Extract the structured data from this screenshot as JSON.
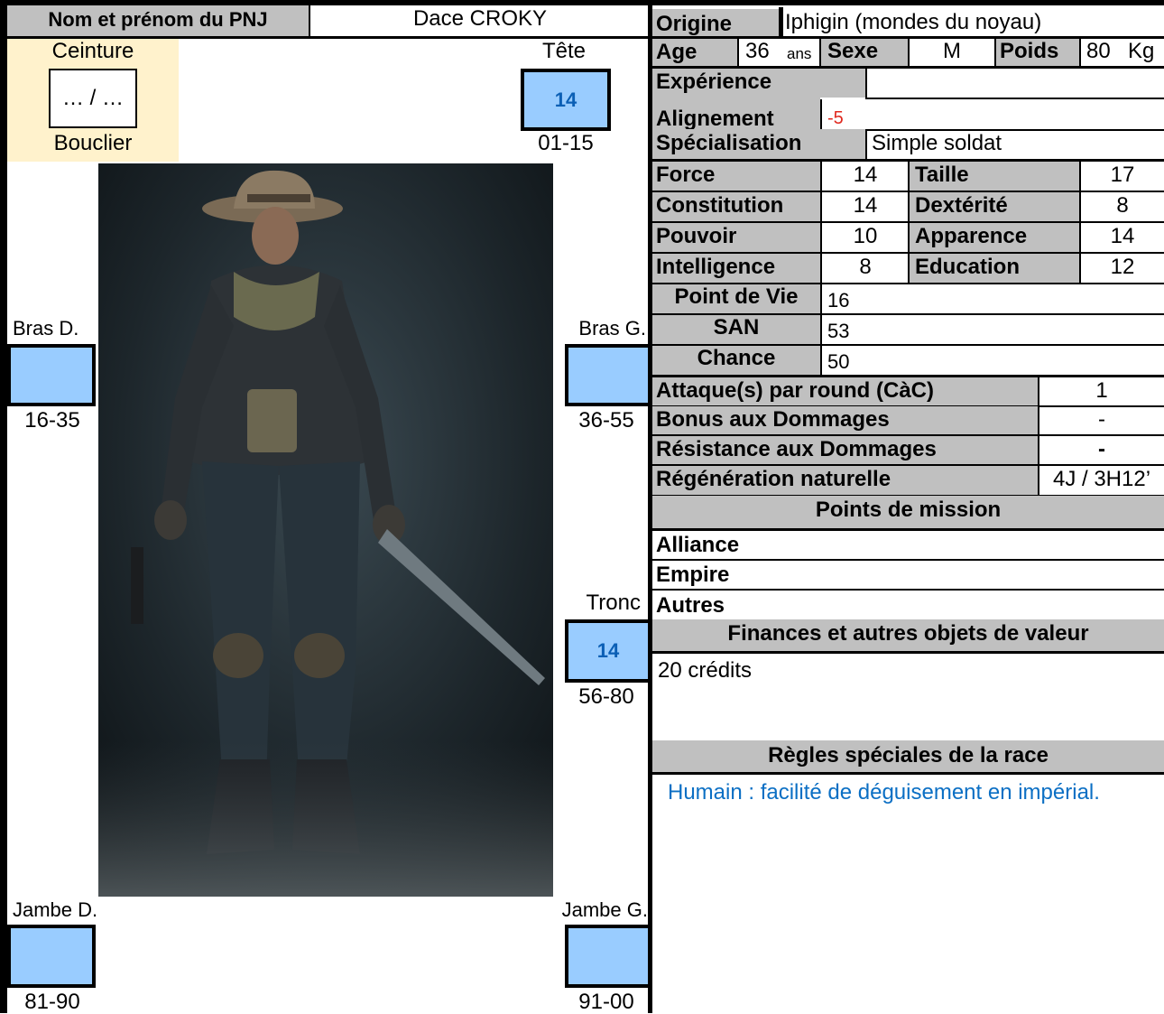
{
  "header": {
    "name_label": "Nom et prénom du PNJ",
    "name_value": "Dace CROKY"
  },
  "armor": {
    "ceinture_label": "Ceinture",
    "value": "… / …",
    "bouclier_label": "Bouclier"
  },
  "locations": {
    "tete": {
      "label": "Tête",
      "value": "14",
      "range": "01-15"
    },
    "bras_d": {
      "label": "Bras D.",
      "value": "",
      "range": "16-35"
    },
    "bras_g": {
      "label": "Bras G.",
      "value": "",
      "range": "36-55"
    },
    "tronc": {
      "label": "Tronc",
      "value": "14",
      "range": "56-80"
    },
    "jambe_d": {
      "label": "Jambe D.",
      "value": "",
      "range": "81-90"
    },
    "jambe_g": {
      "label": "Jambe G.",
      "value": "",
      "range": "91-00"
    }
  },
  "identity": {
    "origine_label": "Origine",
    "origine_value": "Iphigin (mondes du noyau)",
    "age_label": "Age",
    "age_value": "36",
    "age_unit": "ans",
    "sexe_label": "Sexe",
    "sexe_value": "M",
    "poids_label": "Poids",
    "poids_value": "80",
    "poids_unit": "Kg",
    "experience_label": "Expérience",
    "experience_value": "",
    "alignement_label": "Alignement",
    "alignement_value": "-5",
    "specialisation_label": "Spécialisation",
    "specialisation_value": "Simple soldat"
  },
  "stats": [
    {
      "l1": "Force",
      "v1": "14",
      "l2": "Taille",
      "v2": "17"
    },
    {
      "l1": "Constitution",
      "v1": "14",
      "l2": "Dextérité",
      "v2": "8"
    },
    {
      "l1": "Pouvoir",
      "v1": "10",
      "l2": "Apparence",
      "v2": "14"
    },
    {
      "l1": "Intelligence",
      "v1": "8",
      "l2": "Education",
      "v2": "12"
    }
  ],
  "derived": [
    {
      "label": "Point de Vie",
      "value": "16"
    },
    {
      "label": "SAN",
      "value": "53"
    },
    {
      "label": "Chance",
      "value": "50"
    }
  ],
  "combat": [
    {
      "label": "Attaque(s) par round (CàC)",
      "value": "1"
    },
    {
      "label": "Bonus aux Dommages",
      "value": "-"
    },
    {
      "label": "Résistance aux Dommages",
      "value": "-"
    },
    {
      "label": "Régénération naturelle",
      "value": "4J / 3H12’"
    }
  ],
  "mission": {
    "title": "Points de mission",
    "rows": [
      "Alliance",
      "Empire",
      "Autres"
    ]
  },
  "finances": {
    "title": "Finances et autres objets de valeur",
    "value": "20 crédits"
  },
  "race": {
    "title": "Règles spéciales de la race",
    "value": "Humain : facilité de déguisement en impérial."
  },
  "colors": {
    "gray": "#c0c0c0",
    "blue": "#99ccff",
    "red": "#e0281e",
    "link_blue": "#0b6fc4",
    "belt": "#fff2cc"
  }
}
